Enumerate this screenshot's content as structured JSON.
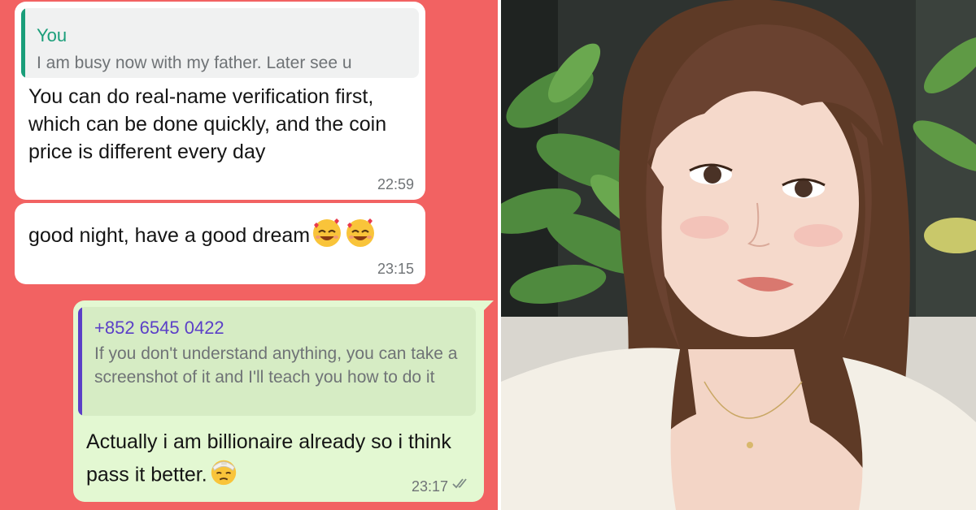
{
  "chat": {
    "msg1": {
      "quote_name": "You",
      "quote_text": "I am busy now with my father. Later see u",
      "text": "You can do real-name verification first, which can be done quickly, and the coin price is different every day",
      "time": "22:59"
    },
    "msg2": {
      "text": "good night, have a good dream",
      "emoji": "smiling-face-with-hearts-icon",
      "time": "23:15"
    },
    "msg3": {
      "quote_name": "+852 6545 0422",
      "quote_text": "If you don't understand anything, you can take a screenshot of it and I'll teach you how to do it",
      "text": "Actually i am billionaire already so i think pass it better.",
      "emoji": "face-with-head-bandage-icon",
      "time": "23:17",
      "status": "read-double-check-icon"
    }
  },
  "colors": {
    "background": "#f26262",
    "incoming_bubble": "#ffffff",
    "outgoing_bubble": "#e3f8d2",
    "quote_you": "#1a9e7a",
    "quote_contact": "#5b3fc7"
  },
  "photo": {
    "subject": "selfie-photo"
  }
}
